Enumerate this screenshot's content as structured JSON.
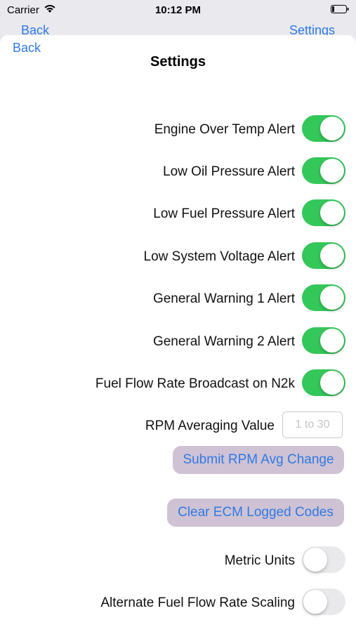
{
  "status_bar": {
    "carrier": "Carrier",
    "time": "10:12 PM"
  },
  "underlying_nav": {
    "back_label": "Back",
    "title": "",
    "settings_label": "Settings"
  },
  "sheet": {
    "back_label": "Back",
    "title": "Settings",
    "toggles": [
      {
        "label": "Engine Over Temp Alert",
        "on": true
      },
      {
        "label": "Low Oil Pressure Alert",
        "on": true
      },
      {
        "label": "Low Fuel Pressure Alert",
        "on": true
      },
      {
        "label": "Low System Voltage Alert",
        "on": true
      },
      {
        "label": "General Warning 1 Alert",
        "on": true
      },
      {
        "label": "General Warning 2 Alert",
        "on": true
      },
      {
        "label": "Fuel Flow Rate Broadcast on N2k",
        "on": true
      }
    ],
    "rpm_averaging": {
      "label": "RPM Averaging Value",
      "placeholder": "1 to 30",
      "value": ""
    },
    "submit_button_label": "Submit RPM Avg Change",
    "clear_button_label": "Clear ECM Logged Codes",
    "bottom_toggles": [
      {
        "label": "Metric Units",
        "on": false
      },
      {
        "label": "Alternate Fuel Flow Rate Scaling",
        "on": false
      }
    ]
  },
  "colors": {
    "accent_blue": "#2f7ae5",
    "switch_on": "#34c759",
    "switch_off": "#e9e9eb",
    "button_bg": "#cfc2d4"
  }
}
